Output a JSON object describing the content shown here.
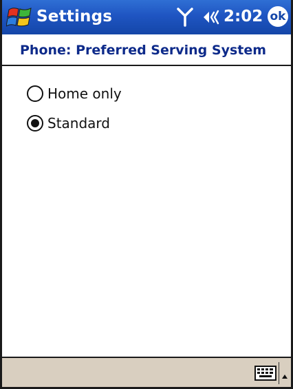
{
  "navbar": {
    "app_title": "Settings",
    "clock": "2:02",
    "ok_label": "ok"
  },
  "page": {
    "title": "Phone: Preferred Serving System"
  },
  "options": [
    {
      "label": "Home only",
      "selected": false
    },
    {
      "label": "Standard",
      "selected": true
    }
  ],
  "colors": {
    "navbar_blue": "#1f55c2",
    "title_blue": "#0d2a8a",
    "menubar": "#d9cfc0"
  },
  "icons": {
    "start": "windows-flag-icon",
    "signal": "antenna-signal-icon",
    "volume": "speaker-volume-icon",
    "keyboard": "keyboard-icon",
    "sip_arrow": "up-arrow-icon"
  }
}
